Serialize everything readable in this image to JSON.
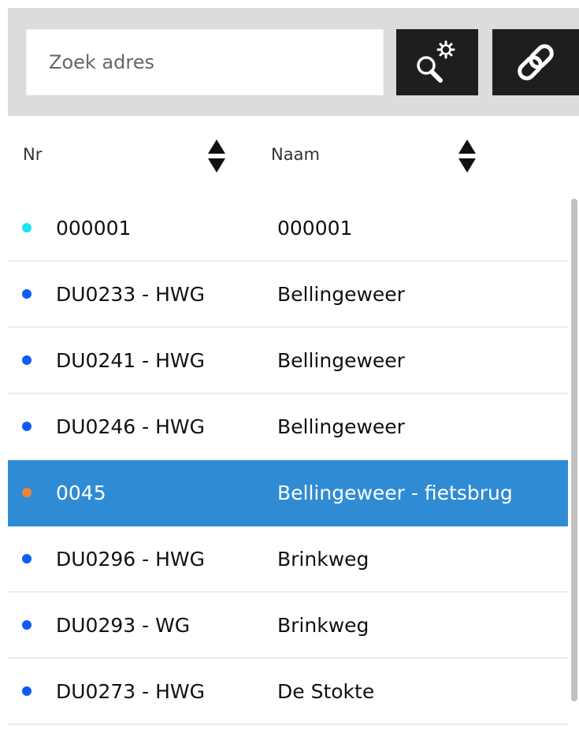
{
  "search": {
    "placeholder": "Zoek adres",
    "value": ""
  },
  "toolbar": {
    "search_settings_icon": "search-gear-icon",
    "link_icon": "link-icon"
  },
  "filters": {
    "nr_placeholder": "Nr",
    "naam_placeholder": "Naam",
    "sort_icon": "sort-up-down-icon"
  },
  "rows": [
    {
      "nr": "000001",
      "naam": "000001",
      "dot_color": "#1ee3f0",
      "selected": false
    },
    {
      "nr": "DU0233 - HWG",
      "naam": "Bellingeweer",
      "dot_color": "#0f5cf0",
      "selected": false
    },
    {
      "nr": "DU0241 - HWG",
      "naam": "Bellingeweer",
      "dot_color": "#0f5cf0",
      "selected": false
    },
    {
      "nr": "DU0246 - HWG",
      "naam": "Bellingeweer",
      "dot_color": "#0f5cf0",
      "selected": false
    },
    {
      "nr": "0045",
      "naam": "Bellingeweer - fietsbrug",
      "dot_color": "#f08235",
      "selected": true
    },
    {
      "nr": "DU0296 - HWG",
      "naam": "Brinkweg",
      "dot_color": "#0f5cf0",
      "selected": false
    },
    {
      "nr": "DU0293 - WG",
      "naam": "Brinkweg",
      "dot_color": "#0f5cf0",
      "selected": false
    },
    {
      "nr": "DU0273 - HWG",
      "naam": "De Stokte",
      "dot_color": "#0f5cf0",
      "selected": false
    }
  ],
  "colors": {
    "selected_row": "#2f8bd3",
    "toolbar_button": "#1e1e1e",
    "header_background": "#dcdcdc"
  }
}
